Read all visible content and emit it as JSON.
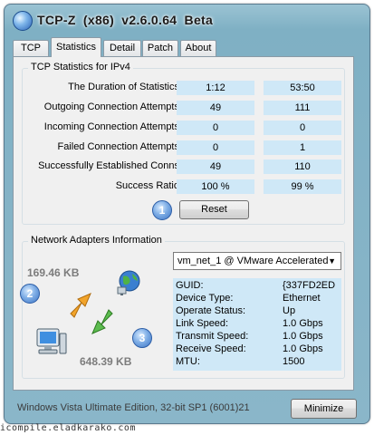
{
  "window": {
    "title": "TCP-Z   (x86)   v2.6.0.64  Beta"
  },
  "tabs": [
    {
      "label": "TCP"
    },
    {
      "label": "Statistics"
    },
    {
      "label": "Detail"
    },
    {
      "label": "Patch"
    },
    {
      "label": "About"
    }
  ],
  "stats": {
    "group_title": "TCP Statistics for IPv4",
    "rows": [
      {
        "label": "The Duration of Statistics",
        "current": "1:12",
        "total": "53:50"
      },
      {
        "label": "Outgoing Connection Attempts",
        "current": "49",
        "total": "111"
      },
      {
        "label": "Incoming Connection Attempts",
        "current": "0",
        "total": "0"
      },
      {
        "label": "Failed Connection Attempts",
        "current": "0",
        "total": "1"
      },
      {
        "label": "Successfully Established Conns",
        "current": "49",
        "total": "110"
      },
      {
        "label": "Success Ratio",
        "current": "100 %",
        "total": "99 %"
      }
    ],
    "badge_1": "1",
    "reset_label": "Reset"
  },
  "network": {
    "group_title": "Network Adapters Information",
    "sent_label": "169.46 KB",
    "received_label": "648.39 KB",
    "badge_2": "2",
    "badge_3": "3",
    "adapter_selected": "vm_net_1 @ VMware Accelerated",
    "info": [
      {
        "key": "GUID:",
        "value": "{337FD2ED"
      },
      {
        "key": "Device Type:",
        "value": "Ethernet"
      },
      {
        "key": "Operate Status:",
        "value": "Up"
      },
      {
        "key": "Link Speed:",
        "value": "1.0 Gbps"
      },
      {
        "key": "Transmit Speed:",
        "value": "1.0 Gbps"
      },
      {
        "key": "Receive Speed:",
        "value": "1.0 Gbps"
      },
      {
        "key": "MTU:",
        "value": "1500"
      }
    ]
  },
  "status_text": "Windows Vista Ultimate Edition, 32-bit SP1 (6001)21",
  "minimize_label": "Minimize",
  "watermark": "icompile.eladkarako.com",
  "icons": [
    "app-globe-icon",
    "globe-network-icon",
    "computer-icon",
    "upload-arrow-icon",
    "download-arrow-icon",
    "dropdown-arrow-icon"
  ],
  "colors": {
    "value_bg": "#cfe8f7",
    "frame": "#8ab6c9",
    "badge": "#3c74c4"
  }
}
